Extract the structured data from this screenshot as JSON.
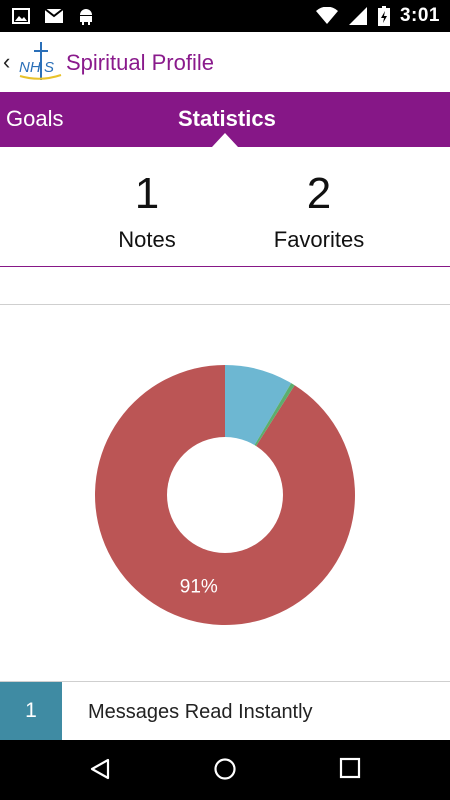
{
  "status_bar": {
    "time": "3:01",
    "left_icons": [
      "image-icon",
      "mail-icon",
      "android-icon"
    ],
    "right_icons": [
      "wifi-icon",
      "signal-icon",
      "battery-icon"
    ]
  },
  "app_bar": {
    "back_icon": "chevron-left-icon",
    "logo_text": "NHTS",
    "title": "Spiritual Profile"
  },
  "tabs": [
    {
      "label": "Goals",
      "active": false
    },
    {
      "label": "Statistics",
      "active": true
    }
  ],
  "stats": [
    {
      "value": "1",
      "label": "Notes"
    },
    {
      "value": "2",
      "label": "Favorites"
    }
  ],
  "chart_data": {
    "type": "pie",
    "donut": true,
    "slices": [
      {
        "value": 91,
        "color": "#bb5555",
        "label": "91%"
      },
      {
        "value": 8.5,
        "color": "#6db7d2",
        "label": ""
      },
      {
        "value": 0.5,
        "color": "#5cae6e",
        "label": ""
      }
    ]
  },
  "list": [
    {
      "count": "1",
      "label": "Messages Read Instantly",
      "color": "#3f8ba3"
    }
  ],
  "colors": {
    "accent": "#861787",
    "title": "#8a1a8c"
  },
  "nav_bar": {
    "icons": [
      "back-triangle-icon",
      "home-circle-icon",
      "recents-square-icon"
    ]
  }
}
